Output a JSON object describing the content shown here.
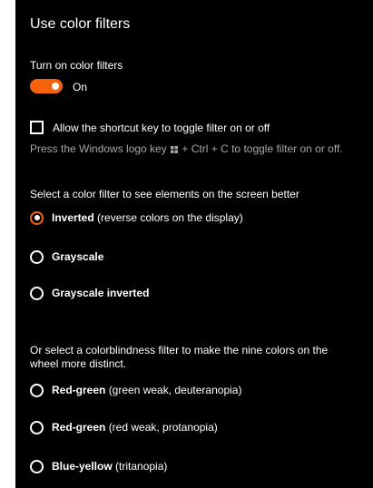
{
  "title": "Use color filters",
  "color_filters": {
    "label": "Turn on color filters",
    "toggle_state": "On",
    "toggle_on": true,
    "accent_color": "#f7630c"
  },
  "shortcut": {
    "checkbox_label": "Allow the shortcut key to toggle filter on or off",
    "checked": false,
    "hint_prefix": "Press the Windows logo key",
    "hint_icon": "windows-logo-icon",
    "hint_suffix": "+ Ctrl + C to toggle filter on or off."
  },
  "filters_section": {
    "heading": "Select a color filter to see elements on the screen better",
    "options": [
      {
        "name": "Inverted",
        "detail": "(reverse colors on the display)",
        "selected": true
      },
      {
        "name": "Grayscale",
        "detail": "",
        "selected": false
      },
      {
        "name": "Grayscale inverted",
        "detail": "",
        "selected": false
      }
    ]
  },
  "colorblind_section": {
    "heading": "Or select a colorblindness filter to make the nine colors on the wheel more distinct.",
    "options": [
      {
        "name": "Red-green",
        "detail": "(green weak, deuteranopia)",
        "selected": false
      },
      {
        "name": "Red-green",
        "detail": "(red weak, protanopia)",
        "selected": false
      },
      {
        "name": "Blue-yellow",
        "detail": "(tritanopia)",
        "selected": false
      }
    ]
  }
}
